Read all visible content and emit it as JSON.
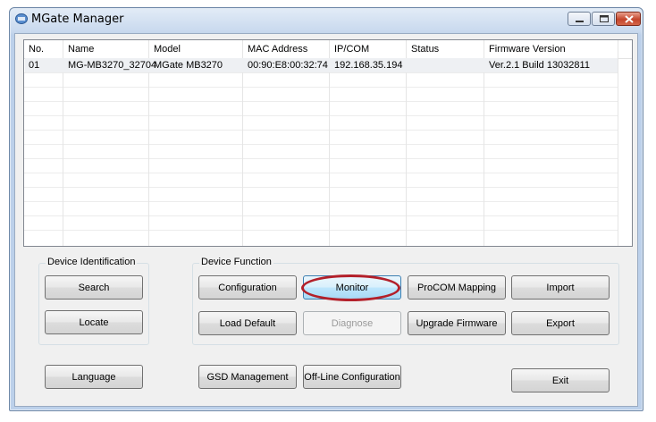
{
  "window": {
    "title": "MGate Manager"
  },
  "device_table": {
    "columns": [
      "No.",
      "Name",
      "Model",
      "MAC Address",
      "IP/COM",
      "Status",
      "Firmware Version"
    ],
    "rows": [
      {
        "no": "01",
        "name": "MG-MB3270_32704",
        "model": "MGate MB3270",
        "mac": "00:90:E8:00:32:74",
        "ip": "192.168.35.194",
        "status": "",
        "firmware": "Ver.2.1 Build 13032811"
      }
    ]
  },
  "device_identification": {
    "label": "Device Identification",
    "search": "Search",
    "locate": "Locate"
  },
  "device_function": {
    "label": "Device Function",
    "configuration": "Configuration",
    "monitor": "Monitor",
    "procom_mapping": "ProCOM Mapping",
    "import": "Import",
    "load_default": "Load Default",
    "diagnose": "Diagnose",
    "upgrade_firmware": "Upgrade Firmware",
    "export": "Export"
  },
  "bottom": {
    "language": "Language",
    "gsd_management": "GSD Management",
    "offline_configuration": "Off-Line Configuration",
    "exit": "Exit"
  },
  "annotation": {
    "highlighted": "Monitor",
    "ring_color": "#b3202a"
  }
}
